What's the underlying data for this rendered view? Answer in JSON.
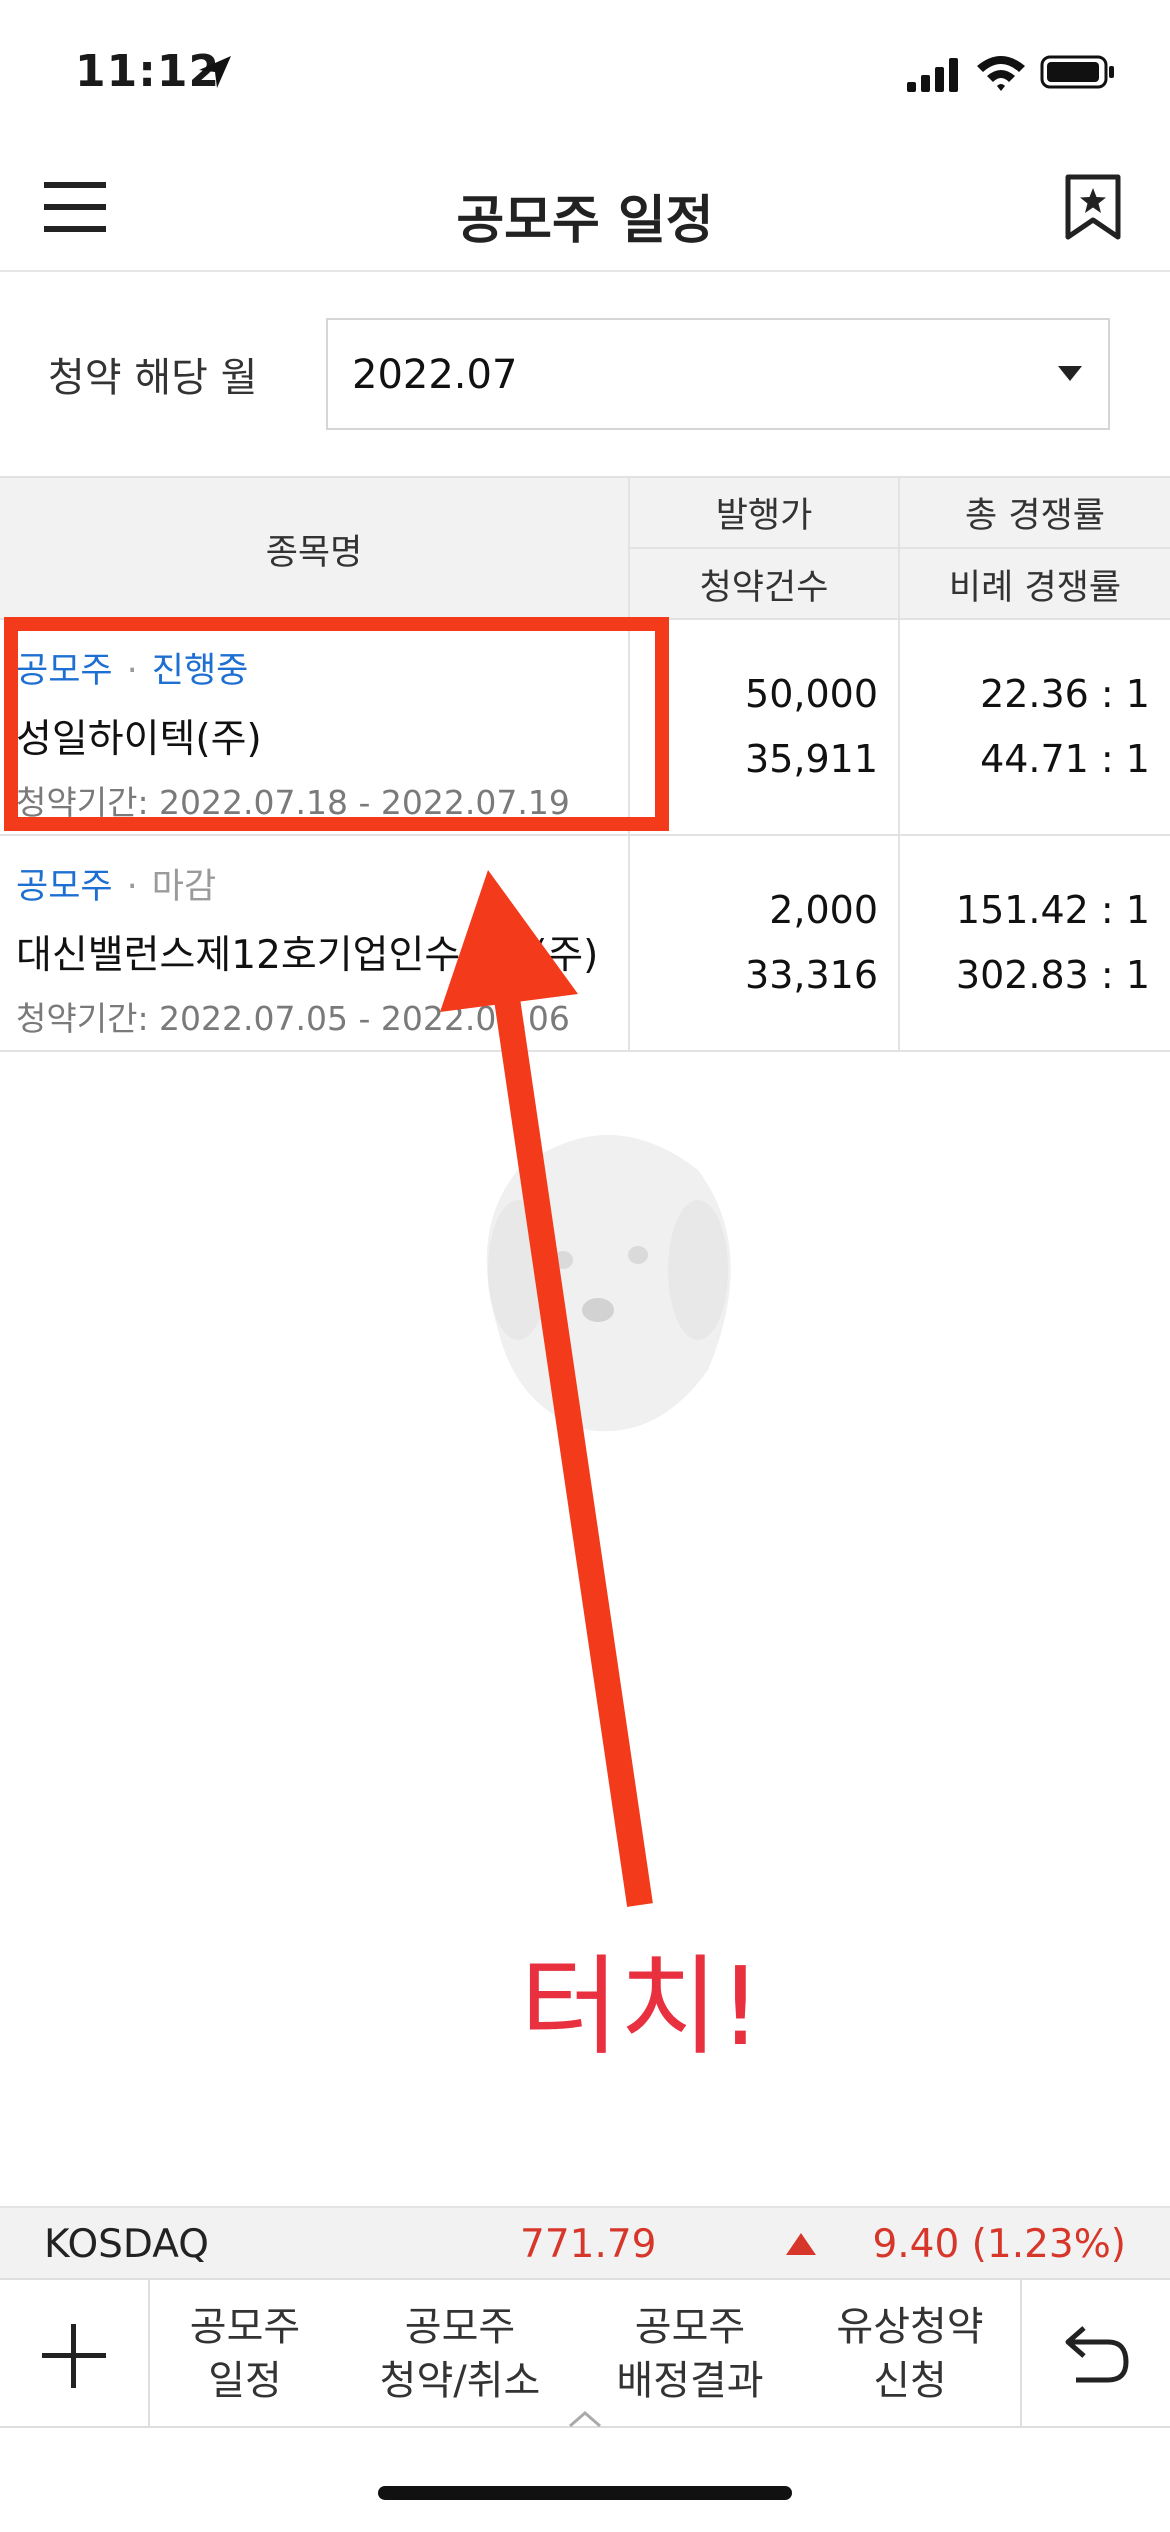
{
  "status_bar": {
    "time": "11:12"
  },
  "header": {
    "title": "공모주 일정"
  },
  "filter": {
    "label": "청약 해당 월",
    "selected_month": "2022.07"
  },
  "table": {
    "columns": {
      "name": "종목명",
      "col1_top": "발행가",
      "col1_bottom": "청약건수",
      "col2_top": "총 경쟁률",
      "col2_bottom": "비례 경쟁률"
    },
    "rows": [
      {
        "type": "공모주",
        "separator": "·",
        "status": "진행중",
        "name": "성일하이텍(주)",
        "period": "청약기간: 2022.07.18 - 2022.07.19",
        "price": "50,000",
        "applications": "35,911",
        "total_rate": "22.36 : 1",
        "proportional_rate": "44.71 : 1"
      },
      {
        "type": "공모주",
        "separator": "·",
        "status": "마감",
        "name": "대신밸런스제12호기업인수목적(주)",
        "period": "청약기간: 2022.07.05 - 2022.07.06",
        "price": "2,000",
        "applications": "33,316",
        "total_rate": "151.42 : 1",
        "proportional_rate": "302.83 : 1"
      }
    ]
  },
  "annotation": {
    "text": "터치!",
    "color": "#f33a1b"
  },
  "ticker": {
    "name": "KOSDAQ",
    "price": "771.79",
    "change": "9.40 (1.23%)",
    "direction": "up",
    "color": "#d7372b"
  },
  "bottom_menu": {
    "items": [
      {
        "line1": "공모주",
        "line2": "일정"
      },
      {
        "line1": "공모주",
        "line2": "청약/취소"
      },
      {
        "line1": "공모주",
        "line2": "배정결과"
      },
      {
        "line1": "유상청약",
        "line2": "신청"
      }
    ]
  },
  "icons": [
    "location-arrow-icon",
    "signal-icon",
    "wifi-icon",
    "battery-icon",
    "menu-icon",
    "bookmark-star-icon",
    "dropdown-caret-icon",
    "up-triangle-icon",
    "plus-icon",
    "back-icon",
    "expand-chevron-icon"
  ]
}
